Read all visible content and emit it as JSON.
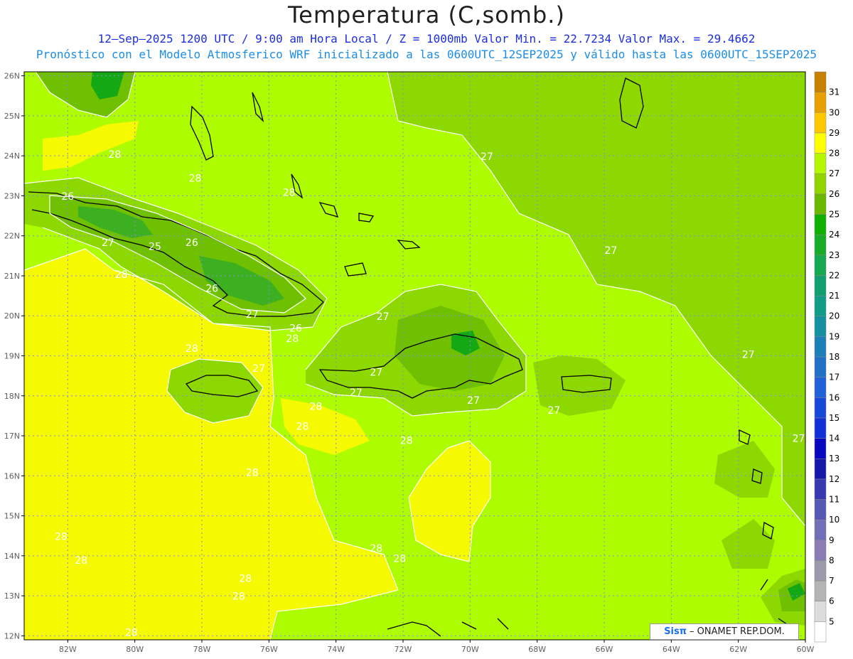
{
  "header": {
    "title": "Temperatura (C,somb.)",
    "subtitle_1": "12–Sep–2025  1200 UTC / 9:00 am Hora Local / Z = 1000mb   Valor Min. = 22.7234  Valor Max. = 29.4662",
    "subtitle_2": "Pronóstico con el Modelo Atmosferico WRF inicializado a las 0600UTC_12SEP2025 y válido hasta las  0600UTC_15SEP2025"
  },
  "colors": {
    "c26": "#6ec000",
    "c27": "#8cd800",
    "c28": "#aefc00",
    "c29": "#f5fa00",
    "c25": "#3cb020",
    "c24": "#14a814",
    "coast": "#000000",
    "contour": "#ffffff",
    "grid": "#8a8ad8"
  },
  "map": {
    "lat_labels": [
      "26N",
      "25N",
      "24N",
      "23N",
      "22N",
      "21N",
      "20N",
      "19N",
      "18N",
      "17N",
      "16N",
      "15N",
      "14N",
      "13N",
      "12N"
    ],
    "lon_labels": [
      "82W",
      "80W",
      "78W",
      "76W",
      "74W",
      "72W",
      "70W",
      "68W",
      "66W",
      "64W",
      "62W",
      "60W"
    ],
    "contour_labels": [
      {
        "text": "28",
        "lon": -80.6,
        "lat": 23.95
      },
      {
        "text": "28",
        "lon": -78.2,
        "lat": 23.35
      },
      {
        "text": "28",
        "lon": -75.4,
        "lat": 23.0
      },
      {
        "text": "26",
        "lon": -82.0,
        "lat": 22.9
      },
      {
        "text": "27",
        "lon": -80.8,
        "lat": 21.75
      },
      {
        "text": "25",
        "lon": -79.4,
        "lat": 21.65
      },
      {
        "text": "26",
        "lon": -78.3,
        "lat": 21.75
      },
      {
        "text": "28",
        "lon": -80.4,
        "lat": 20.95
      },
      {
        "text": "26",
        "lon": -77.7,
        "lat": 20.6
      },
      {
        "text": "27",
        "lon": -76.5,
        "lat": 19.95
      },
      {
        "text": "26",
        "lon": -75.2,
        "lat": 19.6
      },
      {
        "text": "28",
        "lon": -75.3,
        "lat": 19.35
      },
      {
        "text": "28",
        "lon": -78.3,
        "lat": 19.1
      },
      {
        "text": "27",
        "lon": -76.3,
        "lat": 18.6
      },
      {
        "text": "27",
        "lon": -72.6,
        "lat": 19.9
      },
      {
        "text": "27",
        "lon": -72.8,
        "lat": 18.5
      },
      {
        "text": "27",
        "lon": -73.4,
        "lat": 18.0
      },
      {
        "text": "27",
        "lon": -69.9,
        "lat": 17.8
      },
      {
        "text": "27",
        "lon": -67.5,
        "lat": 17.55
      },
      {
        "text": "28",
        "lon": -74.6,
        "lat": 17.65
      },
      {
        "text": "28",
        "lon": -75.0,
        "lat": 17.15
      },
      {
        "text": "28",
        "lon": -71.9,
        "lat": 16.8
      },
      {
        "text": "28",
        "lon": -76.5,
        "lat": 16.0
      },
      {
        "text": "27",
        "lon": -69.5,
        "lat": 23.9
      },
      {
        "text": "27",
        "lon": -65.8,
        "lat": 21.55
      },
      {
        "text": "27",
        "lon": -61.7,
        "lat": 18.95
      },
      {
        "text": "27",
        "lon": -60.2,
        "lat": 16.85
      },
      {
        "text": "28",
        "lon": -82.2,
        "lat": 14.4
      },
      {
        "text": "28",
        "lon": -81.6,
        "lat": 13.8
      },
      {
        "text": "28",
        "lon": -72.8,
        "lat": 14.1
      },
      {
        "text": "28",
        "lon": -72.1,
        "lat": 13.85
      },
      {
        "text": "28",
        "lon": -76.7,
        "lat": 13.35
      },
      {
        "text": "28",
        "lon": -80.1,
        "lat": 12.0
      },
      {
        "text": "28",
        "lon": -76.9,
        "lat": 12.9
      }
    ]
  },
  "colorbar": {
    "ticks": [
      "5",
      "6",
      "7",
      "8",
      "9",
      "10",
      "11",
      "12",
      "13",
      "14",
      "15",
      "16",
      "17",
      "18",
      "19",
      "20",
      "21",
      "22",
      "23",
      "24",
      "25",
      "26",
      "27",
      "28",
      "29",
      "30",
      "31"
    ],
    "colors": [
      "#ffffff",
      "#dcdcdc",
      "#b4b4b4",
      "#9a9aa8",
      "#8c7cb4",
      "#7070b8",
      "#5858b4",
      "#3838b0",
      "#1818a8",
      "#0808c0",
      "#1030d8",
      "#1848d8",
      "#2060d8",
      "#2070c8",
      "#1c80b8",
      "#1490a0",
      "#109c88",
      "#10a070",
      "#14a850",
      "#18ac28",
      "#10b000",
      "#6ab800",
      "#90d400",
      "#b4f800",
      "#ffff00",
      "#ffc800",
      "#e8a000",
      "#c88000"
    ]
  },
  "watermark": {
    "brand": "Sisπ",
    "text": "– ONAMET REP.DOM."
  }
}
